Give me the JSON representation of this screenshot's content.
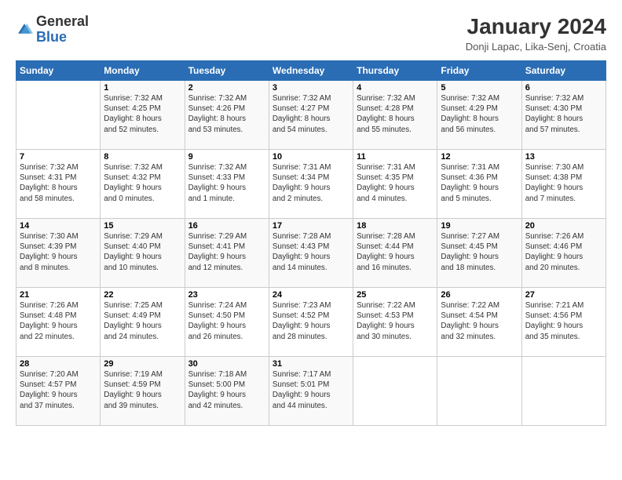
{
  "logo": {
    "general": "General",
    "blue": "Blue"
  },
  "header": {
    "month_year": "January 2024",
    "location": "Donji Lapac, Lika-Senj, Croatia"
  },
  "days_of_week": [
    "Sunday",
    "Monday",
    "Tuesday",
    "Wednesday",
    "Thursday",
    "Friday",
    "Saturday"
  ],
  "weeks": [
    [
      {
        "day": "",
        "info": ""
      },
      {
        "day": "1",
        "info": "Sunrise: 7:32 AM\nSunset: 4:25 PM\nDaylight: 8 hours\nand 52 minutes."
      },
      {
        "day": "2",
        "info": "Sunrise: 7:32 AM\nSunset: 4:26 PM\nDaylight: 8 hours\nand 53 minutes."
      },
      {
        "day": "3",
        "info": "Sunrise: 7:32 AM\nSunset: 4:27 PM\nDaylight: 8 hours\nand 54 minutes."
      },
      {
        "day": "4",
        "info": "Sunrise: 7:32 AM\nSunset: 4:28 PM\nDaylight: 8 hours\nand 55 minutes."
      },
      {
        "day": "5",
        "info": "Sunrise: 7:32 AM\nSunset: 4:29 PM\nDaylight: 8 hours\nand 56 minutes."
      },
      {
        "day": "6",
        "info": "Sunrise: 7:32 AM\nSunset: 4:30 PM\nDaylight: 8 hours\nand 57 minutes."
      }
    ],
    [
      {
        "day": "7",
        "info": "Sunrise: 7:32 AM\nSunset: 4:31 PM\nDaylight: 8 hours\nand 58 minutes."
      },
      {
        "day": "8",
        "info": "Sunrise: 7:32 AM\nSunset: 4:32 PM\nDaylight: 9 hours\nand 0 minutes."
      },
      {
        "day": "9",
        "info": "Sunrise: 7:32 AM\nSunset: 4:33 PM\nDaylight: 9 hours\nand 1 minute."
      },
      {
        "day": "10",
        "info": "Sunrise: 7:31 AM\nSunset: 4:34 PM\nDaylight: 9 hours\nand 2 minutes."
      },
      {
        "day": "11",
        "info": "Sunrise: 7:31 AM\nSunset: 4:35 PM\nDaylight: 9 hours\nand 4 minutes."
      },
      {
        "day": "12",
        "info": "Sunrise: 7:31 AM\nSunset: 4:36 PM\nDaylight: 9 hours\nand 5 minutes."
      },
      {
        "day": "13",
        "info": "Sunrise: 7:30 AM\nSunset: 4:38 PM\nDaylight: 9 hours\nand 7 minutes."
      }
    ],
    [
      {
        "day": "14",
        "info": "Sunrise: 7:30 AM\nSunset: 4:39 PM\nDaylight: 9 hours\nand 8 minutes."
      },
      {
        "day": "15",
        "info": "Sunrise: 7:29 AM\nSunset: 4:40 PM\nDaylight: 9 hours\nand 10 minutes."
      },
      {
        "day": "16",
        "info": "Sunrise: 7:29 AM\nSunset: 4:41 PM\nDaylight: 9 hours\nand 12 minutes."
      },
      {
        "day": "17",
        "info": "Sunrise: 7:28 AM\nSunset: 4:43 PM\nDaylight: 9 hours\nand 14 minutes."
      },
      {
        "day": "18",
        "info": "Sunrise: 7:28 AM\nSunset: 4:44 PM\nDaylight: 9 hours\nand 16 minutes."
      },
      {
        "day": "19",
        "info": "Sunrise: 7:27 AM\nSunset: 4:45 PM\nDaylight: 9 hours\nand 18 minutes."
      },
      {
        "day": "20",
        "info": "Sunrise: 7:26 AM\nSunset: 4:46 PM\nDaylight: 9 hours\nand 20 minutes."
      }
    ],
    [
      {
        "day": "21",
        "info": "Sunrise: 7:26 AM\nSunset: 4:48 PM\nDaylight: 9 hours\nand 22 minutes."
      },
      {
        "day": "22",
        "info": "Sunrise: 7:25 AM\nSunset: 4:49 PM\nDaylight: 9 hours\nand 24 minutes."
      },
      {
        "day": "23",
        "info": "Sunrise: 7:24 AM\nSunset: 4:50 PM\nDaylight: 9 hours\nand 26 minutes."
      },
      {
        "day": "24",
        "info": "Sunrise: 7:23 AM\nSunset: 4:52 PM\nDaylight: 9 hours\nand 28 minutes."
      },
      {
        "day": "25",
        "info": "Sunrise: 7:22 AM\nSunset: 4:53 PM\nDaylight: 9 hours\nand 30 minutes."
      },
      {
        "day": "26",
        "info": "Sunrise: 7:22 AM\nSunset: 4:54 PM\nDaylight: 9 hours\nand 32 minutes."
      },
      {
        "day": "27",
        "info": "Sunrise: 7:21 AM\nSunset: 4:56 PM\nDaylight: 9 hours\nand 35 minutes."
      }
    ],
    [
      {
        "day": "28",
        "info": "Sunrise: 7:20 AM\nSunset: 4:57 PM\nDaylight: 9 hours\nand 37 minutes."
      },
      {
        "day": "29",
        "info": "Sunrise: 7:19 AM\nSunset: 4:59 PM\nDaylight: 9 hours\nand 39 minutes."
      },
      {
        "day": "30",
        "info": "Sunrise: 7:18 AM\nSunset: 5:00 PM\nDaylight: 9 hours\nand 42 minutes."
      },
      {
        "day": "31",
        "info": "Sunrise: 7:17 AM\nSunset: 5:01 PM\nDaylight: 9 hours\nand 44 minutes."
      },
      {
        "day": "",
        "info": ""
      },
      {
        "day": "",
        "info": ""
      },
      {
        "day": "",
        "info": ""
      }
    ]
  ]
}
